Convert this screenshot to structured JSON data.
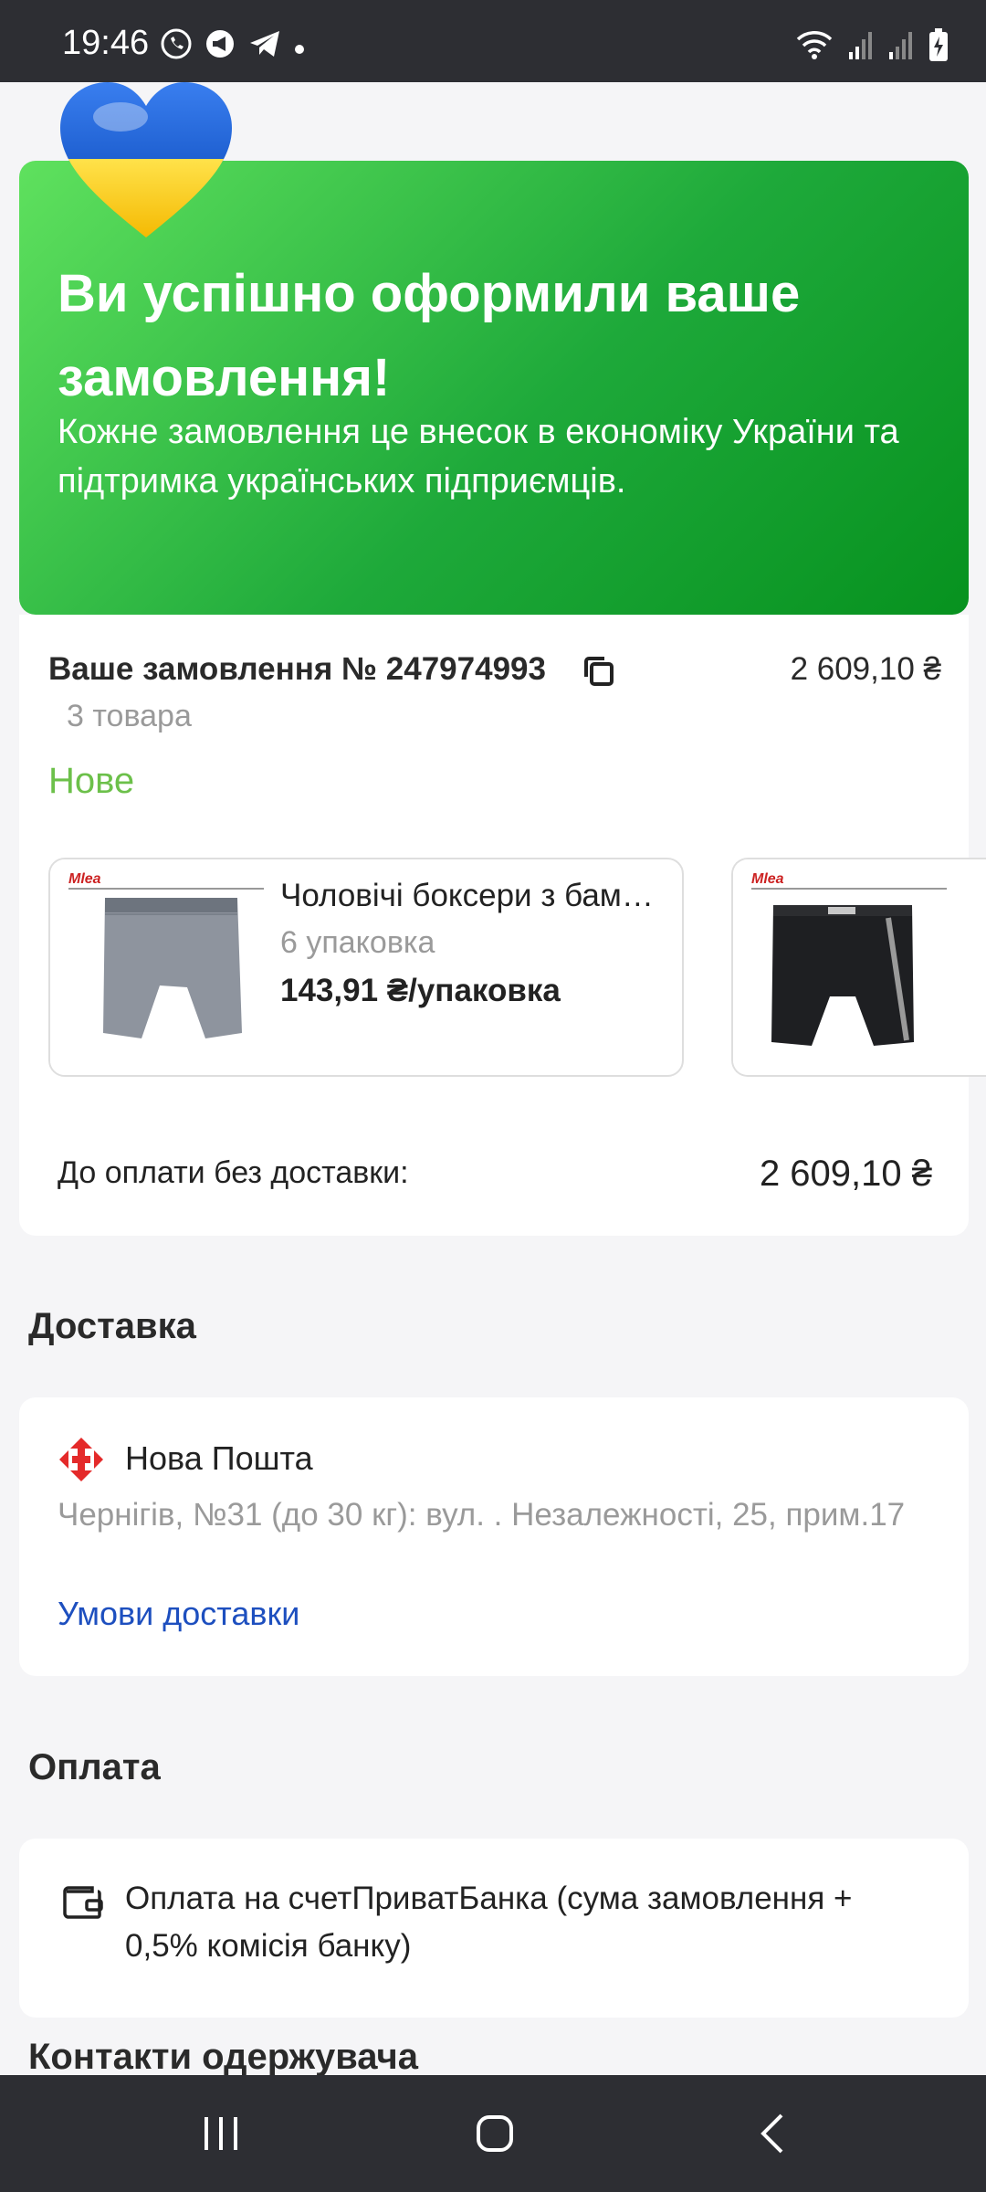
{
  "status_bar": {
    "time": "19:46"
  },
  "hero": {
    "title": "Ви успішно оформили ваше замовлення!",
    "subtitle": "Кожне замовлення це внесок в економіку України та підтримка українських підприємців."
  },
  "order": {
    "title": "Ваше замовлення № 247974993",
    "total": "2 609,10 ₴",
    "items_count": "3 товара",
    "status": "Нове",
    "products": [
      {
        "brand": "Mlea",
        "name": "Чоловічі боксери з бамбука",
        "name_visible": "Чоловічі боксери з бам…",
        "quantity": "6 упаковка",
        "price": "143,91 ₴/упаковка"
      },
      {
        "brand": "Mlea",
        "name": "",
        "quantity": "",
        "price": ""
      }
    ],
    "pay_label": "До оплати без доставки:",
    "pay_value": "2 609,10 ₴"
  },
  "delivery": {
    "section_title": "Доставка",
    "carrier": "Нова Пошта",
    "address": "Чернігів, №31 (до 30 кг): вул. . Незалежності, 25, прим.17",
    "terms_link": "Умови доставки"
  },
  "payment": {
    "section_title": "Оплата",
    "method": "Оплата на счетПриватБанка (сума замовлення + 0,5% комісія банку)"
  },
  "contacts": {
    "section_title": "Контакти одержувача"
  },
  "colors": {
    "hero_green": "#1ea93a",
    "status_new": "#6cc04a",
    "link_blue": "#1d4fbf",
    "novaposhta_red": "#e42a2a"
  }
}
